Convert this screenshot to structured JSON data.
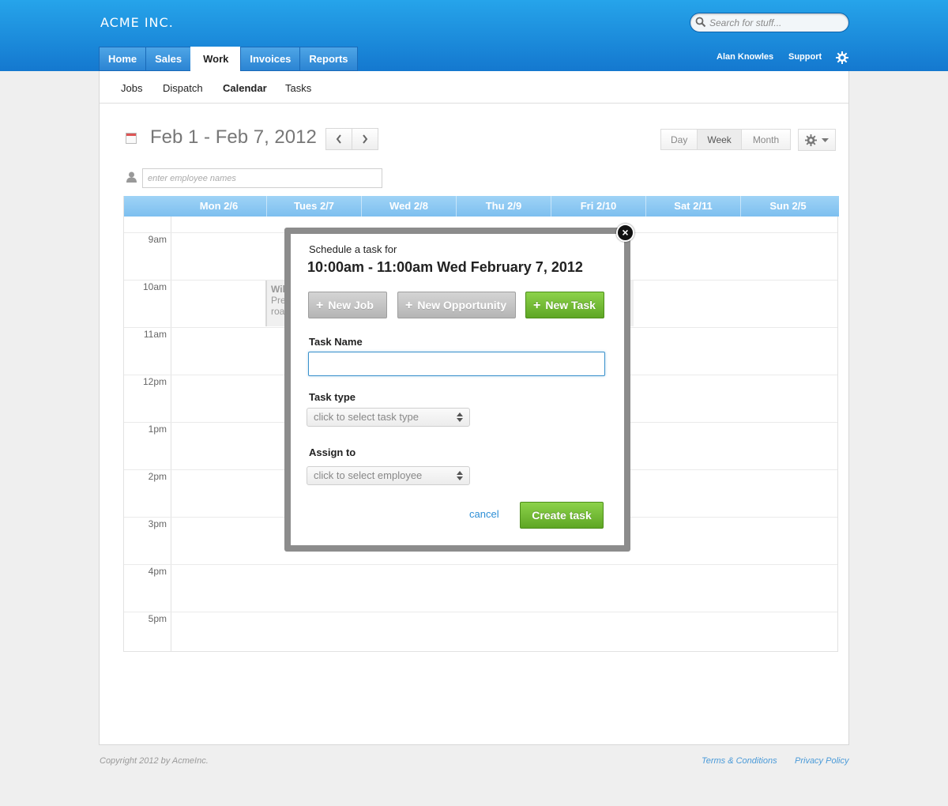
{
  "header": {
    "brand": "ACME INC.",
    "search_placeholder": "Search for stuff...",
    "tabs": [
      {
        "label": "Home"
      },
      {
        "label": "Sales"
      },
      {
        "label": "Work",
        "active": true
      },
      {
        "label": "Invoices"
      },
      {
        "label": "Reports"
      }
    ],
    "user": "Alan Knowles",
    "support": "Support"
  },
  "subnav": {
    "items": [
      {
        "label": "Jobs"
      },
      {
        "label": "Dispatch"
      },
      {
        "label": "Calendar",
        "active": true
      },
      {
        "label": "Tasks"
      }
    ]
  },
  "calendar": {
    "date_range": "Feb 1 - Feb 7, 2012",
    "views": [
      {
        "label": "Day"
      },
      {
        "label": "Week",
        "active": true
      },
      {
        "label": "Month"
      }
    ],
    "employee_placeholder": "enter employee names",
    "days": [
      "Mon 2/6",
      "Tues 2/7",
      "Wed 2/8",
      "Thu 2/9",
      "Fri 2/10",
      "Sat 2/11",
      "Sun 2/5"
    ],
    "hours": [
      "9am",
      "10am",
      "11am",
      "12pm",
      "1pm",
      "2pm",
      "3pm",
      "4pm",
      "5pm"
    ],
    "event": {
      "title": "Wile",
      "line1": "Prep",
      "line2": "road"
    }
  },
  "modal": {
    "subtitle": "Schedule a task for",
    "title": "10:00am - 11:00am Wed February 7, 2012",
    "buttons": {
      "new_job": "New Job",
      "new_opportunity": "New Opportunity",
      "new_task": "New Task"
    },
    "task_name_label": "Task Name",
    "task_name_value": "",
    "task_type_label": "Task type",
    "task_type_placeholder": "click to select task type",
    "assign_label": "Assign to",
    "assign_placeholder": "click to select employee",
    "cancel": "cancel",
    "create": "Create task"
  },
  "footer": {
    "copyright": "Copyright 2012 by AcmeInc.",
    "terms": "Terms & Conditions",
    "privacy": "Privacy Policy"
  },
  "colors": {
    "header_blue": "#1b8ee0",
    "accent_green": "#6db32f",
    "link_blue": "#2e8fd6"
  }
}
